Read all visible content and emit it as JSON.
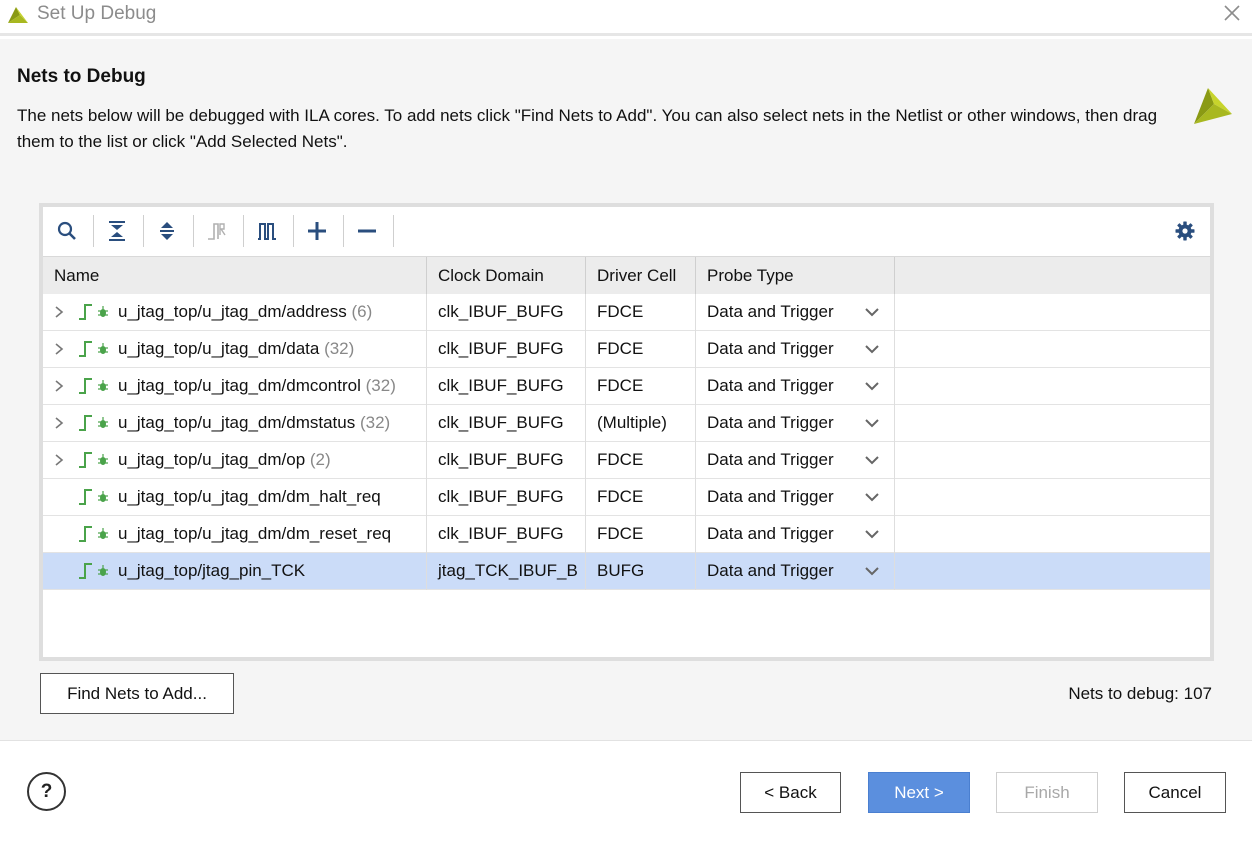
{
  "window": {
    "title": "Set Up Debug"
  },
  "header": {
    "title": "Nets to Debug",
    "description": "The nets below will be debugged with ILA cores. To add nets click \"Find Nets to Add\". You can also select nets in the Netlist or other windows, then drag them to the list or click \"Add Selected Nets\"."
  },
  "table": {
    "columns": [
      "Name",
      "Clock Domain",
      "Driver Cell",
      "Probe Type"
    ],
    "rows": [
      {
        "name": "u_jtag_top/u_jtag_dm/address",
        "count": "(6)",
        "clock": "clk_IBUF_BUFG",
        "driver": "FDCE",
        "probe": "Data and Trigger",
        "expandable": true
      },
      {
        "name": "u_jtag_top/u_jtag_dm/data",
        "count": "(32)",
        "clock": "clk_IBUF_BUFG",
        "driver": "FDCE",
        "probe": "Data and Trigger",
        "expandable": true
      },
      {
        "name": "u_jtag_top/u_jtag_dm/dmcontrol",
        "count": "(32)",
        "clock": "clk_IBUF_BUFG",
        "driver": "FDCE",
        "probe": "Data and Trigger",
        "expandable": true
      },
      {
        "name": "u_jtag_top/u_jtag_dm/dmstatus",
        "count": "(32)",
        "clock": "clk_IBUF_BUFG",
        "driver": "(Multiple)",
        "probe": "Data and Trigger",
        "expandable": true
      },
      {
        "name": "u_jtag_top/u_jtag_dm/op",
        "count": "(2)",
        "clock": "clk_IBUF_BUFG",
        "driver": "FDCE",
        "probe": "Data and Trigger",
        "expandable": true
      },
      {
        "name": "u_jtag_top/u_jtag_dm/dm_halt_req",
        "count": "",
        "clock": "clk_IBUF_BUFG",
        "driver": "FDCE",
        "probe": "Data and Trigger",
        "expandable": false
      },
      {
        "name": "u_jtag_top/u_jtag_dm/dm_reset_req",
        "count": "",
        "clock": "clk_IBUF_BUFG",
        "driver": "FDCE",
        "probe": "Data and Trigger",
        "expandable": false
      },
      {
        "name": "u_jtag_top/jtag_pin_TCK",
        "count": "",
        "clock": "jtag_TCK_IBUF_B",
        "driver": "BUFG",
        "probe": "Data and Trigger",
        "expandable": false,
        "selected": true
      }
    ]
  },
  "buttons": {
    "find_nets": "Find Nets to Add...",
    "back": "< Back",
    "next": "Next >",
    "finish": "Finish",
    "cancel": "Cancel",
    "help": "?"
  },
  "status": {
    "nets_to_debug": "Nets to debug: 107"
  },
  "toolbar_icons": [
    "search-icon",
    "collapse-all-icon",
    "expand-all-icon",
    "clock-edge-icon",
    "waveform-icon",
    "add-icon",
    "remove-icon",
    "settings-icon"
  ],
  "colors": {
    "accent": "#5b8fde",
    "selected_row": "#cbdcf8",
    "icon_blue": "#2a4e7e",
    "icon_green": "#4aa34a",
    "logo_yellow": "#a8b820"
  }
}
